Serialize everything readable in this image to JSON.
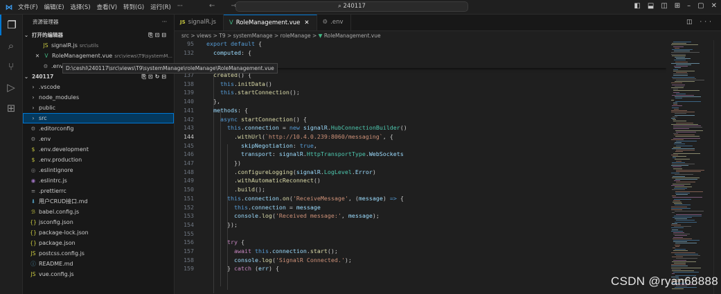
{
  "titlebar": {
    "menu": [
      "文件(F)",
      "编辑(E)",
      "选择(S)",
      "查看(V)",
      "转到(G)",
      "运行(R)",
      "···"
    ],
    "search": "240117",
    "nav": "← →"
  },
  "sidebar": {
    "title": "资源管理器",
    "open_editors_label": "打开的编辑器",
    "open_editors": [
      {
        "name": "signalR.js",
        "path": "src\\utils",
        "icon": "JS"
      },
      {
        "name": "RoleManagement.vue",
        "path": "src\\views\\T9\\systemM...",
        "icon": "V"
      },
      {
        "name": ".env",
        "path": "",
        "icon": "⚙"
      }
    ],
    "tooltip": "D:\\ceshi\\240117\\src\\views\\T9\\systemManage\\roleManage\\RoleManagement.vue",
    "project": "240117",
    "tree": [
      {
        "name": ".vscode",
        "icon": "›"
      },
      {
        "name": "node_modules",
        "icon": "›"
      },
      {
        "name": "public",
        "icon": "›"
      },
      {
        "name": "src",
        "icon": "›"
      },
      {
        "name": ".editorconfig",
        "icon": "⚙"
      },
      {
        "name": ".env",
        "icon": "⚙"
      },
      {
        "name": ".env.development",
        "icon": "$"
      },
      {
        "name": ".env.production",
        "icon": "$"
      },
      {
        "name": ".eslintignore",
        "icon": "◎"
      },
      {
        "name": ".eslintrc.js",
        "icon": "◉"
      },
      {
        "name": ".prettierrc",
        "icon": "≡"
      },
      {
        "name": "用户CRUD接口.md",
        "icon": "⬇"
      },
      {
        "name": "babel.config.js",
        "icon": "ℬ"
      },
      {
        "name": "jsconfig.json",
        "icon": "{}"
      },
      {
        "name": "package-lock.json",
        "icon": "{}"
      },
      {
        "name": "package.json",
        "icon": "{}"
      },
      {
        "name": "postcss.config.js",
        "icon": "JS"
      },
      {
        "name": "README.md",
        "icon": "ⓘ"
      },
      {
        "name": "vue.config.js",
        "icon": "JS"
      }
    ]
  },
  "tabs": [
    {
      "label": "signalR.js",
      "icon": "JS"
    },
    {
      "label": "RoleManagement.vue",
      "icon": "V"
    },
    {
      "label": ".env",
      "icon": "⚙"
    }
  ],
  "breadcrumb": "src > views > T9 > systemManage > roleManage > ",
  "breadcrumb_file": "RoleManagement.vue",
  "code": [
    {
      "n": "95",
      "html": "<span class='kw'>export</span> <span class='kw'>default</span> {"
    },
    {
      "n": "132",
      "html": "  <span class='prop'>computed</span>: {"
    },
    {
      "n": "136",
      "html": "  },"
    },
    {
      "n": "137",
      "html": "  <span class='fn'>created</span>() {"
    },
    {
      "n": "138",
      "html": "    <span class='kw'>this</span>.<span class='fn'>initData</span>()"
    },
    {
      "n": "139",
      "html": "    <span class='kw'>this</span>.<span class='fn'>startConnection</span>();"
    },
    {
      "n": "140",
      "html": "  },"
    },
    {
      "n": "141",
      "html": "  <span class='prop'>methods</span>: {"
    },
    {
      "n": "142",
      "html": "    <span class='kw'>async</span> <span class='fn'>startConnection</span>() {"
    },
    {
      "n": "143",
      "html": "      <span class='kw'>this</span>.<span class='prop'>connection</span> = <span class='kw'>new</span> <span class='prop'>signalR</span>.<span class='cls'>HubConnectionBuilder</span>()"
    },
    {
      "n": "144",
      "html": "        .<span class='fn'>withUrl</span>(<span class='str'>`http://10.4.0.239:8060/messaging`</span>, {"
    },
    {
      "n": "145",
      "html": "          <span class='prop'>skipNegotiation</span>: <span class='lit'>true</span>,"
    },
    {
      "n": "146",
      "html": "          <span class='prop'>transport</span>: <span class='prop'>signalR</span>.<span class='cls'>HttpTransportType</span>.<span class='prop'>WebSockets</span>"
    },
    {
      "n": "147",
      "html": "        })"
    },
    {
      "n": "148",
      "html": "        .<span class='fn'>configureLogging</span>(<span class='prop'>signalR</span>.<span class='cls'>LogLevel</span>.<span class='prop'>Error</span>)"
    },
    {
      "n": "149",
      "html": "        .<span class='fn'>withAutomaticReconnect</span>()"
    },
    {
      "n": "150",
      "html": "        .<span class='fn'>build</span>();"
    },
    {
      "n": "151",
      "html": "      <span class='kw'>this</span>.<span class='prop'>connection</span>.<span class='fn'>on</span>(<span class='str'>'ReceiveMessage'</span>, (<span class='prop'>message</span>) <span class='kw'>=&gt;</span> {"
    },
    {
      "n": "152",
      "html": "        <span class='kw'>this</span>.<span class='prop'>connection</span> = <span class='prop'>message</span>"
    },
    {
      "n": "153",
      "html": "        <span class='prop'>console</span>.<span class='fn'>log</span>(<span class='str'>'Received message:'</span>, <span class='prop'>message</span>);"
    },
    {
      "n": "154",
      "html": "      });"
    },
    {
      "n": "155",
      "html": ""
    },
    {
      "n": "156",
      "html": "      <span class='ctl'>try</span> {"
    },
    {
      "n": "157",
      "html": "        <span class='ctl'>await</span> <span class='kw'>this</span>.<span class='prop'>connection</span>.<span class='fn'>start</span>();"
    },
    {
      "n": "158",
      "html": "        <span class='prop'>console</span>.<span class='fn'>log</span>(<span class='str'>'SignalR Connected.'</span>);"
    },
    {
      "n": "159",
      "html": "      } <span class='ctl'>catch</span> (<span class='prop'>err</span>) {"
    }
  ],
  "current_line": "144",
  "watermark": "CSDN @ryan68888",
  "colors": {
    "accent": "#0078d4",
    "vue": "#41b883",
    "js": "#cbcb41",
    "selection": "#04395e"
  }
}
